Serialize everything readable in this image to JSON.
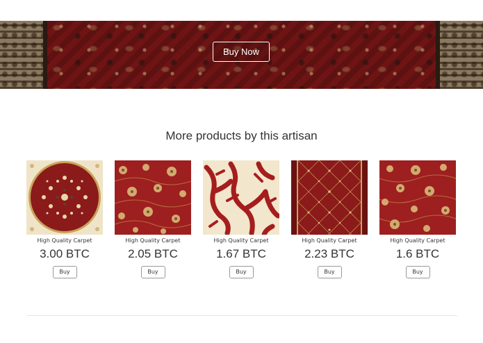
{
  "hero": {
    "button_label": "Buy Now"
  },
  "section": {
    "title": "More products by this artisan"
  },
  "products": [
    {
      "name": "High Quality Carpet",
      "price": "3.00 BTC",
      "buy_label": "Buy"
    },
    {
      "name": "High Quality Carpet",
      "price": "2.05 BTC",
      "buy_label": "Buy"
    },
    {
      "name": "High Quality Carpet",
      "price": "1.67 BTC",
      "buy_label": "Buy"
    },
    {
      "name": "High Quality Carpet",
      "price": "2.23 BTC",
      "buy_label": "Buy"
    },
    {
      "name": "High Quality Carpet",
      "price": "1.6 BTC",
      "buy_label": "Buy"
    }
  ],
  "colors": {
    "carpet_red": "#8b1a1a",
    "carpet_cream": "#efe4c8",
    "carpet_gold": "#c9a35a"
  }
}
